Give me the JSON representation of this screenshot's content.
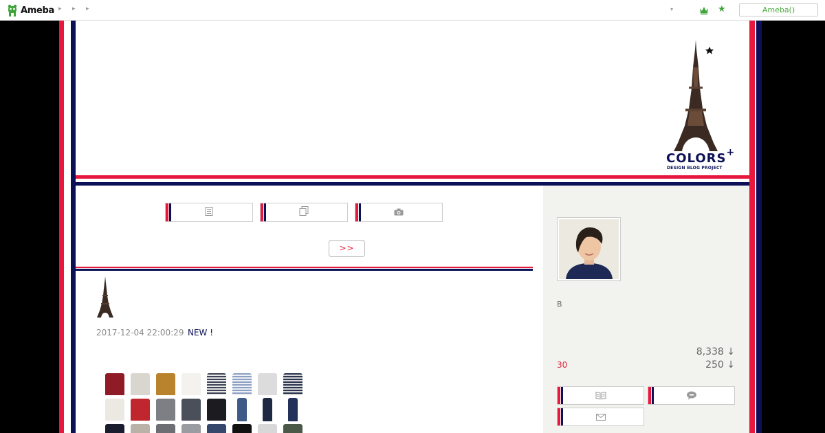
{
  "topbar": {
    "logo_text": "Ameba",
    "crumb_arrows": [
      "▸",
      "▸",
      "▸"
    ],
    "dropdown_arrow": "▾",
    "ameba_button": "Ameba()"
  },
  "header": {
    "brand_text": "COLORS",
    "brand_plus": "+",
    "brand_sub": "DESIGN BLOG PROJECT"
  },
  "nav": {
    "buttons": [
      {
        "icon": "document-icon"
      },
      {
        "icon": "copy-icon"
      },
      {
        "icon": "camera-icon"
      }
    ],
    "more_label": ">>"
  },
  "entry": {
    "date": "2017-12-04 22:00:29",
    "new_tag": "NEW !"
  },
  "sidebar": {
    "b_label": "B",
    "count1": "8,338 ↓",
    "count2": "250 ↓",
    "thirty": "30",
    "buttons": [
      {
        "icon": "book-icon"
      },
      {
        "icon": "comment-icon"
      },
      {
        "icon": "mail-icon"
      }
    ]
  },
  "colors": {
    "red": "#e8173d",
    "navy": "#0c1057",
    "ameba_green": "#47a93b",
    "sidebar_bg": "#f2f2ee"
  }
}
